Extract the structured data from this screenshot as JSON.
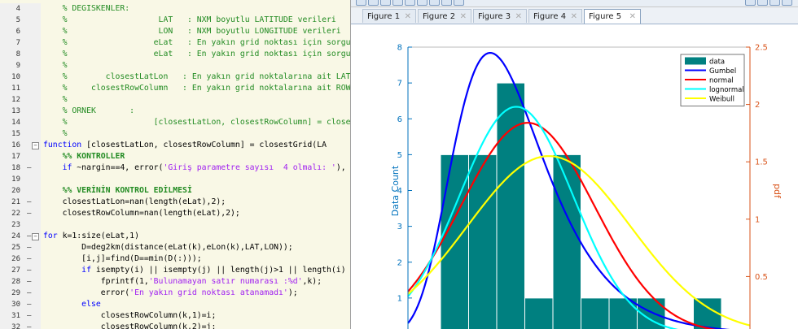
{
  "editor": {
    "lines": [
      {
        "num": "4",
        "dash": false,
        "fold": "",
        "tokens": [
          {
            "t": "    % DEGISKENLER:",
            "c": "c-comment"
          }
        ]
      },
      {
        "num": "5",
        "dash": false,
        "fold": "",
        "tokens": [
          {
            "t": "    %                   LAT   : NXM boyutlu LATITUDE verileri",
            "c": "c-comment"
          }
        ]
      },
      {
        "num": "6",
        "dash": false,
        "fold": "",
        "tokens": [
          {
            "t": "    %                   LON   : NXM boyutlu LONGITUDE verileri",
            "c": "c-comment"
          }
        ]
      },
      {
        "num": "7",
        "dash": false,
        "fold": "",
        "tokens": [
          {
            "t": "    %                  eLat   : En yakın grid noktası için sorgula",
            "c": "c-comment"
          }
        ]
      },
      {
        "num": "8",
        "dash": false,
        "fold": "",
        "tokens": [
          {
            "t": "    %                  eLat   : En yakın grid noktası için sorgula",
            "c": "c-comment"
          }
        ]
      },
      {
        "num": "9",
        "dash": false,
        "fold": "",
        "tokens": [
          {
            "t": "    %",
            "c": "c-comment"
          }
        ]
      },
      {
        "num": "10",
        "dash": false,
        "fold": "",
        "tokens": [
          {
            "t": "    %        closestLatLon   : En yakın grid noktalarına ait LATI",
            "c": "c-comment"
          }
        ]
      },
      {
        "num": "11",
        "dash": false,
        "fold": "",
        "tokens": [
          {
            "t": "    %     closestRowColumn   : En yakın grid noktalarına ait ROW-",
            "c": "c-comment"
          }
        ]
      },
      {
        "num": "12",
        "dash": false,
        "fold": "",
        "tokens": [
          {
            "t": "    %",
            "c": "c-comment"
          }
        ]
      },
      {
        "num": "13",
        "dash": false,
        "fold": "",
        "tokens": [
          {
            "t": "    % ORNEK       :",
            "c": "c-comment"
          }
        ]
      },
      {
        "num": "14",
        "dash": false,
        "fold": "",
        "tokens": [
          {
            "t": "    %                  [closestLatLon, closestRowColumn] = closestGr",
            "c": "c-comment"
          }
        ]
      },
      {
        "num": "15",
        "dash": false,
        "fold": "",
        "tokens": [
          {
            "t": "    %",
            "c": "c-comment"
          }
        ]
      },
      {
        "num": "16",
        "dash": false,
        "fold": "−",
        "tokens": [
          {
            "t": "function",
            "c": "c-kw"
          },
          {
            "t": " [closestLatLon, closestRowColumn] = closestGrid(LA",
            "c": "c-plain"
          }
        ]
      },
      {
        "num": "17",
        "dash": false,
        "fold": "",
        "tokens": [
          {
            "t": "    %% KONTROLLER",
            "c": "c-sec"
          }
        ]
      },
      {
        "num": "18",
        "dash": true,
        "fold": "",
        "tokens": [
          {
            "t": "    if",
            "c": "c-kw"
          },
          {
            "t": " ~nargin==4, error(",
            "c": "c-plain"
          },
          {
            "t": "'Giriş parametre sayısı  4 olmalı: '",
            "c": "c-str"
          },
          {
            "t": "),",
            "c": "c-plain"
          }
        ]
      },
      {
        "num": "19",
        "dash": false,
        "fold": "",
        "tokens": [
          {
            "t": "",
            "c": "c-plain"
          }
        ]
      },
      {
        "num": "20",
        "dash": false,
        "fold": "",
        "tokens": [
          {
            "t": "    %% VERİNİN KONTROL EDİLMESİ",
            "c": "c-sec"
          }
        ]
      },
      {
        "num": "21",
        "dash": true,
        "fold": "",
        "tokens": [
          {
            "t": "    closestLatLon=nan(length(eLat),2);",
            "c": "c-plain"
          }
        ]
      },
      {
        "num": "22",
        "dash": true,
        "fold": "",
        "tokens": [
          {
            "t": "    closestRowColumn=nan(length(eLat),2);",
            "c": "c-plain"
          }
        ]
      },
      {
        "num": "23",
        "dash": false,
        "fold": "",
        "tokens": [
          {
            "t": "",
            "c": "c-plain"
          }
        ]
      },
      {
        "num": "24",
        "dash": true,
        "fold": "−",
        "tokens": [
          {
            "t": "for",
            "c": "c-kw"
          },
          {
            "t": " k=1:size(eLat,1)",
            "c": "c-plain"
          }
        ]
      },
      {
        "num": "25",
        "dash": true,
        "fold": "",
        "tokens": [
          {
            "t": "        D=deg2km(distance(eLat(k),eLon(k),LAT,LON));",
            "c": "c-plain"
          }
        ]
      },
      {
        "num": "26",
        "dash": true,
        "fold": "",
        "tokens": [
          {
            "t": "        [i,j]=find(D==min(D(:)));",
            "c": "c-plain"
          }
        ]
      },
      {
        "num": "27",
        "dash": true,
        "fold": "",
        "tokens": [
          {
            "t": "        if",
            "c": "c-kw"
          },
          {
            "t": " isempty(i) || isempty(j) || length(j)>1 || length(i)",
            "c": "c-plain"
          }
        ]
      },
      {
        "num": "28",
        "dash": true,
        "fold": "",
        "tokens": [
          {
            "t": "            fprintf(1,",
            "c": "c-plain"
          },
          {
            "t": "'Bulunamayan satır numarası :%d'",
            "c": "c-str"
          },
          {
            "t": ",k);",
            "c": "c-plain"
          }
        ]
      },
      {
        "num": "29",
        "dash": true,
        "fold": "",
        "tokens": [
          {
            "t": "            error(",
            "c": "c-plain"
          },
          {
            "t": "'En yakın grid noktası atanamadı'",
            "c": "c-str"
          },
          {
            "t": ");",
            "c": "c-plain"
          }
        ]
      },
      {
        "num": "30",
        "dash": true,
        "fold": "",
        "tokens": [
          {
            "t": "        else",
            "c": "c-kw"
          }
        ]
      },
      {
        "num": "31",
        "dash": true,
        "fold": "",
        "tokens": [
          {
            "t": "            closestRowColumn(k,1)=i;",
            "c": "c-plain"
          }
        ]
      },
      {
        "num": "32",
        "dash": true,
        "fold": "",
        "tokens": [
          {
            "t": "            closestRowColumn(k,2)=j;",
            "c": "c-plain"
          }
        ]
      }
    ]
  },
  "figure_window": {
    "toolbar_icons": [
      "new-figure-icon",
      "open-icon",
      "save-icon",
      "print-icon",
      "zoom-in-icon",
      "zoom-out-icon",
      "pan-icon",
      "rotate-icon",
      "data-cursor-icon",
      "colorbar-icon",
      "legend-icon",
      "tile-icon",
      "dock-icon"
    ],
    "tabs": [
      {
        "label": "Figure 1",
        "active": false
      },
      {
        "label": "Figure 2",
        "active": false
      },
      {
        "label": "Figure 3",
        "active": false
      },
      {
        "label": "Figure 4",
        "active": false
      },
      {
        "label": "Figure 5",
        "active": true
      }
    ],
    "tab_close": "✕"
  },
  "chart_data": {
    "type": "bar",
    "title": "",
    "ylabel_left": "Data Count",
    "ylabel_right": "pdf",
    "ylim_left": [
      0,
      8
    ],
    "ylim_right": [
      0,
      2.5
    ],
    "yticks_left": [
      "1",
      "2",
      "3",
      "4",
      "5",
      "6",
      "7",
      "8"
    ],
    "yticks_right": [
      "0.5",
      "1",
      "1.5",
      "2",
      "2.5"
    ],
    "colors": {
      "left_axis": "#0072bd",
      "right_axis": "#d95319",
      "bars": "#008080"
    },
    "histogram": [
      {
        "bin": 1,
        "value": 5
      },
      {
        "bin": 2,
        "value": 5
      },
      {
        "bin": 3,
        "value": 7
      },
      {
        "bin": 4,
        "value": 1
      },
      {
        "bin": 5,
        "value": 5
      },
      {
        "bin": 6,
        "value": 1
      },
      {
        "bin": 7,
        "value": 1
      },
      {
        "bin": 8,
        "value": 1
      },
      {
        "bin": 9,
        "value": 0
      },
      {
        "bin": 10,
        "value": 1
      }
    ],
    "series": [
      {
        "name": "Gumbel",
        "color": "#0000ff"
      },
      {
        "name": "normal",
        "color": "#ff0000"
      },
      {
        "name": "lognormal",
        "color": "#00ffff"
      },
      {
        "name": "Weibull",
        "color": "#ffff00"
      }
    ],
    "legend": {
      "placement": "top-right",
      "entries": [
        {
          "name": "data",
          "color": "#008080",
          "kind": "patch"
        },
        {
          "name": "Gumbel",
          "color": "#0000ff",
          "kind": "line"
        },
        {
          "name": "normal",
          "color": "#ff0000",
          "kind": "line"
        },
        {
          "name": "lognormal",
          "color": "#00ffff",
          "kind": "line"
        },
        {
          "name": "Weibull",
          "color": "#ffff00",
          "kind": "line"
        }
      ]
    }
  }
}
